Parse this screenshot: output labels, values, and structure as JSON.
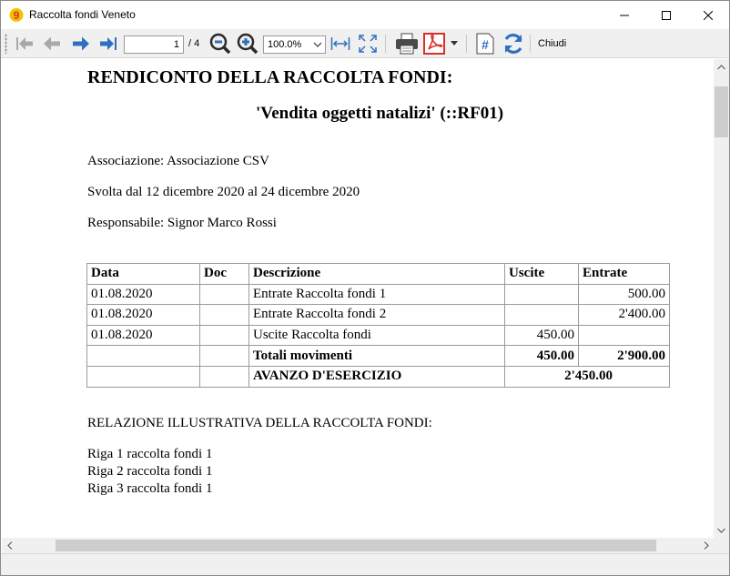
{
  "window": {
    "title": "Raccolta fondi Veneto",
    "app_icon": "banana-app-icon",
    "controls": [
      "minimize-icon",
      "maximize-icon",
      "close-icon"
    ]
  },
  "toolbar": {
    "page_value": "1",
    "page_total": "/ 4",
    "zoom_value": "100.0%",
    "close_label": "Chiudi",
    "icons": [
      "first-page-icon",
      "previous-page-icon",
      "next-page-icon",
      "last-page-icon",
      "zoom-out-icon",
      "zoom-in-icon",
      "fit-width-icon",
      "fit-page-icon",
      "print-icon",
      "pdf-icon",
      "dropdown-icon",
      "page-number-icon",
      "refresh-icon"
    ],
    "colors": {
      "nav_blue": "#2f6fc0",
      "nav_disabled": "#a8a8a8",
      "pdf_red": "#d9302a"
    }
  },
  "document": {
    "title": "RENDICONTO DELLA RACCOLTA FONDI:",
    "subtitle": "'Vendita oggetti natalizi' (::RF01)",
    "association": "Associazione: Associazione CSV",
    "period": "Svolta dal 12 dicembre 2020 al 24 dicembre 2020",
    "manager": "Responsabile: Signor Marco Rossi",
    "table": {
      "headers": [
        "Data",
        "Doc",
        "Descrizione",
        "Uscite",
        "Entrate"
      ],
      "rows": [
        {
          "data": "01.08.2020",
          "doc": "",
          "descrizione": "Entrate Raccolta fondi 1",
          "uscite": "",
          "entrate": "500.00"
        },
        {
          "data": "01.08.2020",
          "doc": "",
          "descrizione": "Entrate Raccolta fondi 2",
          "uscite": "",
          "entrate": "2'400.00"
        },
        {
          "data": "01.08.2020",
          "doc": "",
          "descrizione": "Uscite Raccolta fondi",
          "uscite": "450.00",
          "entrate": ""
        }
      ],
      "totals": {
        "label": "Totali movimenti",
        "uscite": "450.00",
        "entrate": "2'900.00"
      },
      "surplus": {
        "label": "AVANZO D'ESERCIZIO",
        "value": "2'450.00"
      }
    },
    "report_heading": "RELAZIONE ILLUSTRATIVA DELLA RACCOLTA FONDI:",
    "report_lines": [
      "Riga 1 raccolta fondi 1",
      "Riga 2 raccolta fondi 1",
      "Riga 3 raccolta fondi 1"
    ]
  }
}
